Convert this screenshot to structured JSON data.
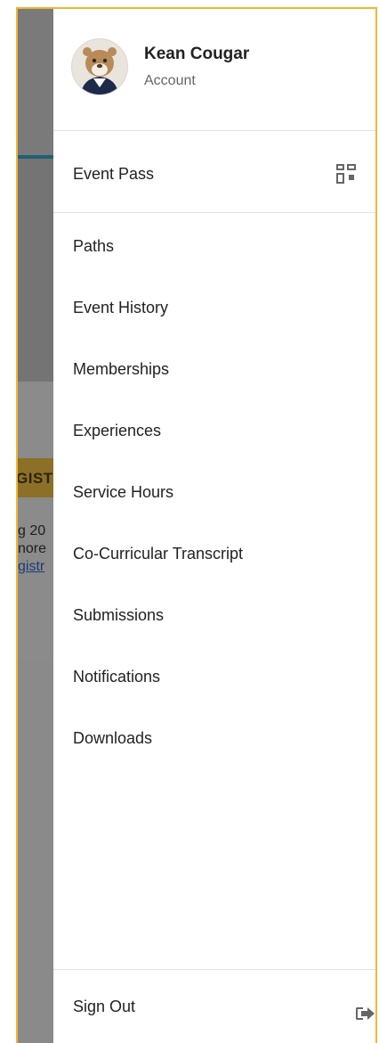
{
  "background": {
    "banner_text": "GIST",
    "text_lines": [
      "g 20",
      "nore",
      "gistr"
    ]
  },
  "drawer": {
    "profile": {
      "name": "Kean Cougar",
      "subtitle": "Account"
    },
    "event_pass": {
      "label": "Event Pass",
      "icon": "qr-code-icon"
    },
    "items": [
      {
        "label": "Paths"
      },
      {
        "label": "Event History"
      },
      {
        "label": "Memberships"
      },
      {
        "label": "Experiences"
      },
      {
        "label": "Service Hours"
      },
      {
        "label": "Co-Curricular Transcript"
      },
      {
        "label": "Submissions"
      },
      {
        "label": "Notifications"
      },
      {
        "label": "Downloads"
      }
    ],
    "sign_out": {
      "label": "Sign Out",
      "icon": "sign-out-icon"
    }
  },
  "colors": {
    "frame_border": "#f2b531",
    "overlay": "#808080",
    "accent_bar": "#1f5f74",
    "banner": "#8c7027"
  }
}
